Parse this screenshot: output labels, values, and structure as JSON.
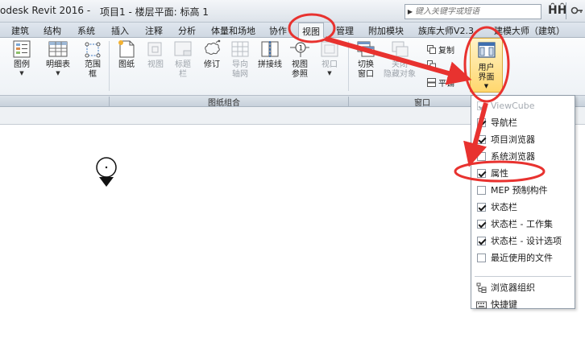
{
  "titlebar": {
    "app_title": "odesk Revit 2016 -",
    "project_title": "项目1 - 楼层平面: 标高 1",
    "search_placeholder": "键入关键字或短语"
  },
  "tabs": [
    "建筑",
    "结构",
    "系统",
    "插入",
    "注释",
    "分析",
    "体量和场地",
    "协作",
    "视图",
    "管理",
    "附加模块",
    "族库大师V2.3",
    "建模大师（建筑）"
  ],
  "active_tab": "视图",
  "ribbon": {
    "legend": "图例",
    "schedule": "明细表",
    "scope_box_line1": "范围",
    "scope_box_line2": "框",
    "sheet": "图纸",
    "view": "视图",
    "title_block_line1": "标题",
    "title_block_line2": "栏",
    "revision": "修订",
    "guide_grid_line1": "导向",
    "guide_grid_line2": "轴网",
    "matchline": "拼接线",
    "view_ref_line1": "视图",
    "view_ref_line2": "参照",
    "viewport_line1": "视口",
    "switch_window_line1": "切换",
    "switch_window_line2": "窗口",
    "close_hidden_line1": "关闭",
    "close_hidden_line2": "隐藏对象",
    "duplicate": "复制",
    "tile": "平铺",
    "user_interface_line1": "用户",
    "user_interface_line2": "界面",
    "marker_number": "1"
  },
  "panels": {
    "sheet_composition": "图纸组合",
    "windows": "窗口"
  },
  "menu": {
    "items": [
      {
        "label": "ViewCube",
        "checked": true,
        "disabled": true
      },
      {
        "label": "导航栏",
        "checked": true,
        "disabled": false
      },
      {
        "label": "项目浏览器",
        "checked": true,
        "disabled": false
      },
      {
        "label": "系统浏览器",
        "checked": false,
        "disabled": false
      },
      {
        "label": "属性",
        "checked": true,
        "disabled": false
      },
      {
        "label": "MEP 预制构件",
        "checked": false,
        "disabled": false
      },
      {
        "label": "状态栏",
        "checked": true,
        "disabled": false
      },
      {
        "label": "状态栏 - 工作集",
        "checked": true,
        "disabled": false
      },
      {
        "label": "状态栏 - 设计选项",
        "checked": true,
        "disabled": false
      },
      {
        "label": "最近使用的文件",
        "checked": false,
        "disabled": false
      }
    ],
    "browser_org": "浏览器组织",
    "shortcuts": "快捷键"
  },
  "colors": {
    "annotation_red": "#e8322f",
    "ribbon_bg": "#eef2f6",
    "highlight_button": "#ffd76e"
  },
  "icons": {
    "search": "binoculars-icon",
    "key": "key-icon",
    "user_interface": "user-interface-icon"
  }
}
